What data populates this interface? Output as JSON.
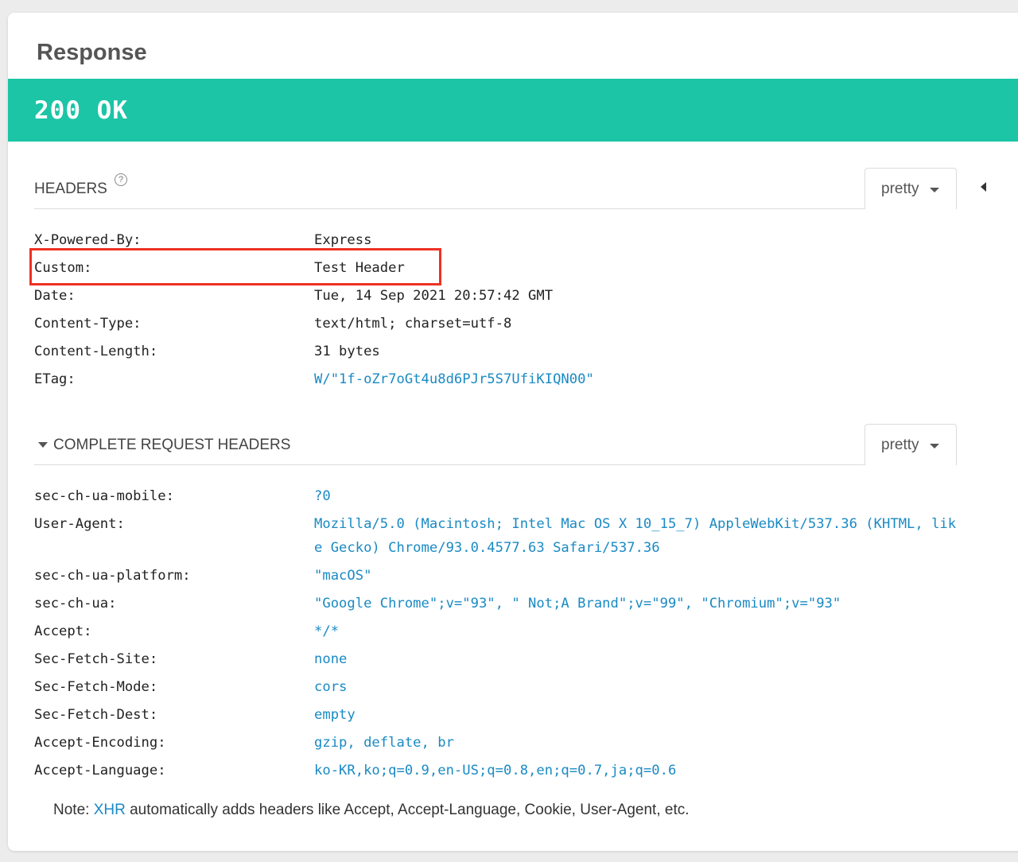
{
  "panel": {
    "title": "Response"
  },
  "status": {
    "text": "200 OK",
    "color": "#1bc5a6"
  },
  "response_headers": {
    "label": "HEADERS",
    "help_icon": "question-circle-icon",
    "format": "pretty",
    "rows": [
      {
        "key": "X-Powered-By:",
        "value": "Express"
      },
      {
        "key": "Custom:",
        "value": "Test Header"
      },
      {
        "key": "Date:",
        "value": "Tue, 14 Sep 2021 20:57:42 GMT"
      },
      {
        "key": "Content-Type:",
        "value": "text/html; charset=utf-8"
      },
      {
        "key": "Content-Length:",
        "value": "31 bytes"
      },
      {
        "key": "ETag:",
        "value": "W/\"1f-oZr7oGt4u8d6PJr5S7UfiKIQN00\""
      }
    ]
  },
  "request_headers": {
    "label": "COMPLETE REQUEST HEADERS",
    "format": "pretty",
    "rows": [
      {
        "key": "sec-ch-ua-mobile:",
        "value": "?0"
      },
      {
        "key": "User-Agent:",
        "value": "Mozilla/5.0 (Macintosh; Intel Mac OS X 10_15_7) AppleWebKit/537.36 (KHTML, like Gecko) Chrome/93.0.4577.63 Safari/537.36"
      },
      {
        "key": "sec-ch-ua-platform:",
        "value": "\"macOS\""
      },
      {
        "key": "sec-ch-ua:",
        "value": "\"Google Chrome\";v=\"93\", \" Not;A Brand\";v=\"99\", \"Chromium\";v=\"93\""
      },
      {
        "key": "Accept:",
        "value": "*/*"
      },
      {
        "key": "Sec-Fetch-Site:",
        "value": "none"
      },
      {
        "key": "Sec-Fetch-Mode:",
        "value": "cors"
      },
      {
        "key": "Sec-Fetch-Dest:",
        "value": "empty"
      },
      {
        "key": "Accept-Encoding:",
        "value": "gzip, deflate, br"
      },
      {
        "key": "Accept-Language:",
        "value": "ko-KR,ko;q=0.9,en-US;q=0.8,en;q=0.7,ja;q=0.6"
      }
    ]
  },
  "note": {
    "prefix": "Note: ",
    "link": "XHR",
    "suffix": " automatically adds headers like Accept, Accept-Language, Cookie, User-Agent, etc."
  },
  "colors": {
    "link": "#1a8ac4",
    "highlight": "#ee3124"
  }
}
